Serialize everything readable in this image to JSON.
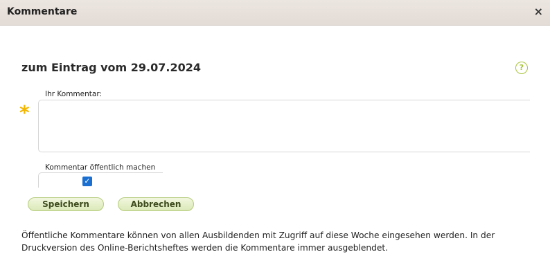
{
  "dialog": {
    "title": "Kommentare",
    "close_label": "×"
  },
  "heading": "zum Eintrag vom 29.07.2024",
  "help_label": "?",
  "form": {
    "comment_label": "Ihr Kommentar:",
    "required_mark": "*",
    "comment_value": "",
    "public_label": "Kommentar öffentlich machen",
    "public_checked": true,
    "checkbox_glyph": "✓"
  },
  "buttons": {
    "save": "Speichern",
    "cancel": "Abbrechen"
  },
  "info_text": "Öffentliche Kommentare können von allen Ausbildenden mit Zugriff auf diese Woche eingesehen werden. In der Druckversion des Online-Berichtsheftes werden die Kommentare immer ausgeblendet.",
  "colors": {
    "accent_green": "#a8c43a",
    "required_yellow": "#f3b600",
    "checkbox_blue": "#1a6fd1"
  }
}
